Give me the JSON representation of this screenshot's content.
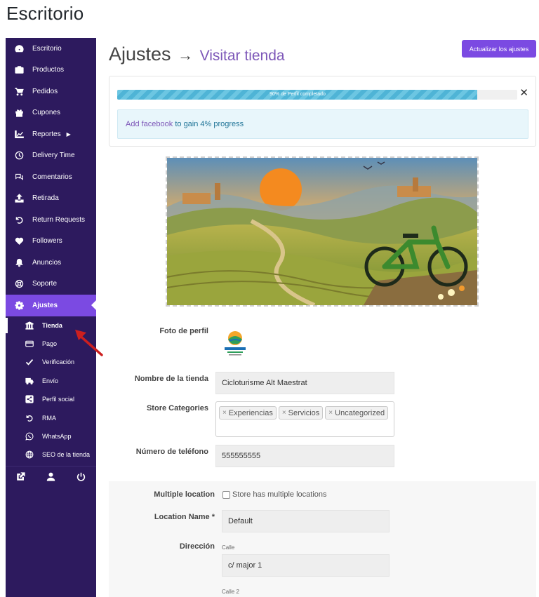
{
  "header": {
    "title": "Escritorio"
  },
  "sidebar": {
    "items": [
      {
        "label": "Escritorio",
        "icon": "dashboard-icon"
      },
      {
        "label": "Productos",
        "icon": "briefcase-icon"
      },
      {
        "label": "Pedidos",
        "icon": "cart-icon"
      },
      {
        "label": "Cupones",
        "icon": "gift-icon"
      },
      {
        "label": "Reportes",
        "icon": "chart-icon"
      },
      {
        "label": "Delivery Time",
        "icon": "clock-icon"
      },
      {
        "label": "Comentarios",
        "icon": "comments-icon"
      },
      {
        "label": "Retirada",
        "icon": "upload-icon"
      },
      {
        "label": "Return Requests",
        "icon": "undo-icon"
      },
      {
        "label": "Followers",
        "icon": "heart-icon"
      },
      {
        "label": "Anuncios",
        "icon": "bell-icon"
      },
      {
        "label": "Soporte",
        "icon": "lifebuoy-icon"
      },
      {
        "label": "Ajustes",
        "icon": "gear-icon"
      }
    ],
    "sub_items": [
      {
        "label": "Tienda",
        "icon": "bank-icon"
      },
      {
        "label": "Pago",
        "icon": "credit-card-icon"
      },
      {
        "label": "Verificación",
        "icon": "check-icon"
      },
      {
        "label": "Envío",
        "icon": "truck-icon"
      },
      {
        "label": "Perfil social",
        "icon": "share-icon"
      },
      {
        "label": "RMA",
        "icon": "undo-icon"
      },
      {
        "label": "WhatsApp",
        "icon": "whatsapp-icon"
      },
      {
        "label": "SEO de la tienda",
        "icon": "globe-icon"
      }
    ],
    "footer_icons": [
      "external-link-icon",
      "user-icon",
      "power-icon"
    ],
    "active_color": "#7b4ae2",
    "bg_color": "#2d1a5e"
  },
  "main": {
    "heading": "Ajustes",
    "arrow": "→",
    "visit_link": "Visitar tienda",
    "update_button": "Actualizar los ajustes"
  },
  "progress": {
    "percent": 90,
    "label": "90% de Perfil completado",
    "hint_link": "Add facebook",
    "hint_text": " to gain 4% progress"
  },
  "form": {
    "profile_photo_label": "Foto de perfil",
    "store_name_label": "Nombre de la tienda",
    "store_name_value": "Cicloturisme Alt Maestrat",
    "categories_label": "Store Categories",
    "categories": [
      "Experiencias",
      "Servicios",
      "Uncategorized"
    ],
    "phone_label": "Número de teléfono",
    "phone_value": "555555555",
    "multiple_location_label": "Multiple location",
    "multiple_location_checkbox": "Store has multiple locations",
    "location_name_label": "Location Name *",
    "location_name_value": "Default",
    "address_label": "Dirección",
    "street_label": "Calle",
    "street_value": "c/ major 1",
    "street2_label": "Calle 2"
  }
}
